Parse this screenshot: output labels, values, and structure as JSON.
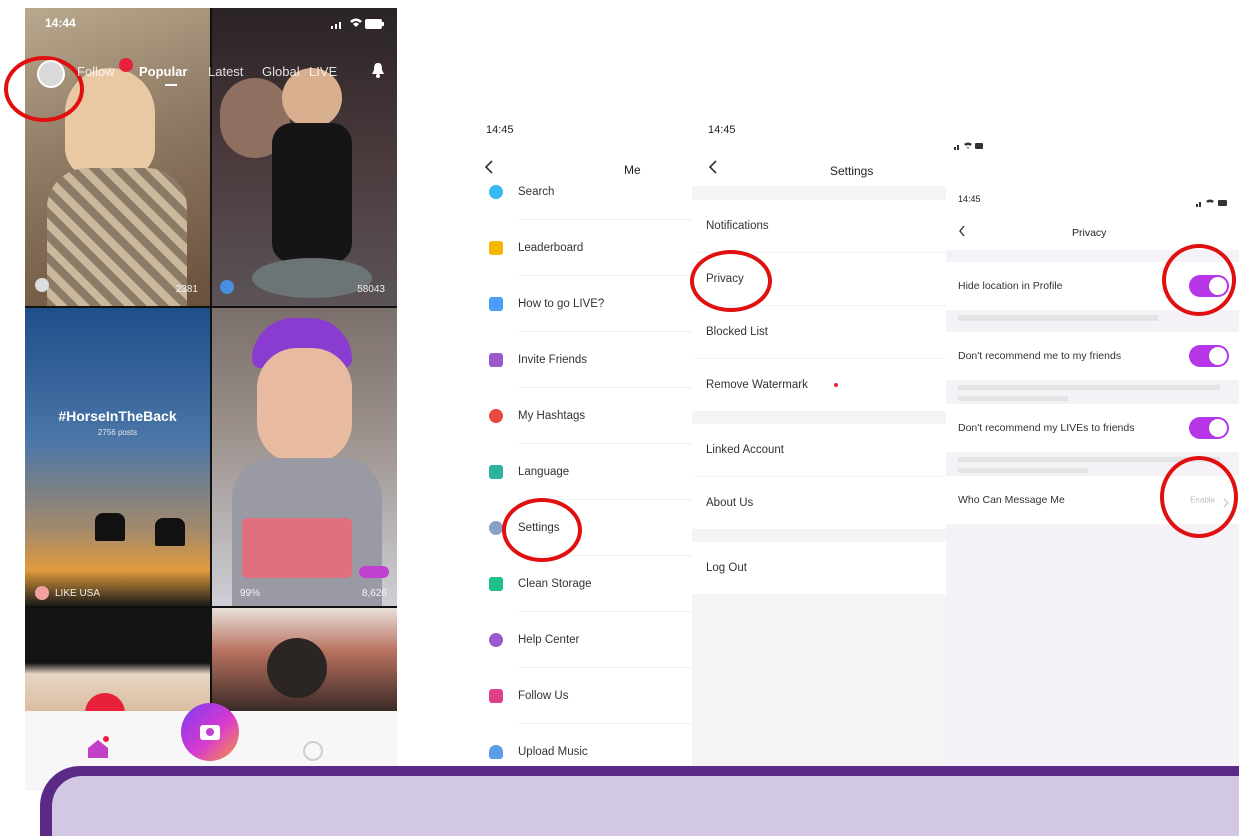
{
  "feed": {
    "status": {
      "time": "14:44"
    },
    "tabs": {
      "follow": "Follow",
      "badge": "",
      "popular": "Popular",
      "latest": "Latest",
      "global": "Global",
      "live": "LIVE"
    },
    "tiles": [
      {
        "count": "2381"
      },
      {
        "count": "58043"
      },
      {
        "hashtag": "#HorseInTheBack",
        "sub": "2756 posts",
        "tag_user": "LIKE USA"
      },
      {
        "user": "99%",
        "count": "8,626"
      }
    ]
  },
  "me": {
    "status": {
      "time": "14:45"
    },
    "title": "Me",
    "items": [
      {
        "label": "Search",
        "color": "#3ab7f0"
      },
      {
        "label": "Leaderboard",
        "color": "#f4b400"
      },
      {
        "label": "How to go LIVE?",
        "color": "#4a9ef5"
      },
      {
        "label": "Invite Friends",
        "color": "#9b59d0"
      },
      {
        "label": "My Hashtags",
        "color": "#e84a3c"
      },
      {
        "label": "Language",
        "color": "#2bb5a0"
      },
      {
        "label": "Settings",
        "color": "#8aa0c8"
      },
      {
        "label": "Clean Storage",
        "color": "#1fbf8f"
      },
      {
        "label": "Help Center",
        "color": "#9b59d0"
      },
      {
        "label": "Follow Us",
        "color": "#e0408a"
      },
      {
        "label": "Upload Music",
        "color": "#5a9de8"
      }
    ]
  },
  "settings": {
    "status": {
      "time": "14:45"
    },
    "title": "Settings",
    "items": [
      {
        "label": "Notifications"
      },
      {
        "label": "Privacy"
      },
      {
        "label": "Blocked List"
      },
      {
        "label": "Remove Watermark"
      },
      {
        "label": "Linked Account"
      },
      {
        "label": "About Us"
      },
      {
        "label": "Log Out"
      }
    ]
  },
  "privacy": {
    "status": {
      "time": "14:45"
    },
    "title": "Privacy",
    "rows": [
      {
        "label": "Hide location in Profile",
        "toggle": true
      },
      {
        "label": "Don't recommend me to my friends",
        "toggle": true
      },
      {
        "label": "Don't recommend my LIVEs to friends",
        "toggle": true
      },
      {
        "label": "Who Can Message Me",
        "value": "Enable"
      }
    ]
  },
  "colors": {
    "accent": "#b636e8",
    "highlight": "#e01010",
    "banner": "#5b2a86"
  }
}
